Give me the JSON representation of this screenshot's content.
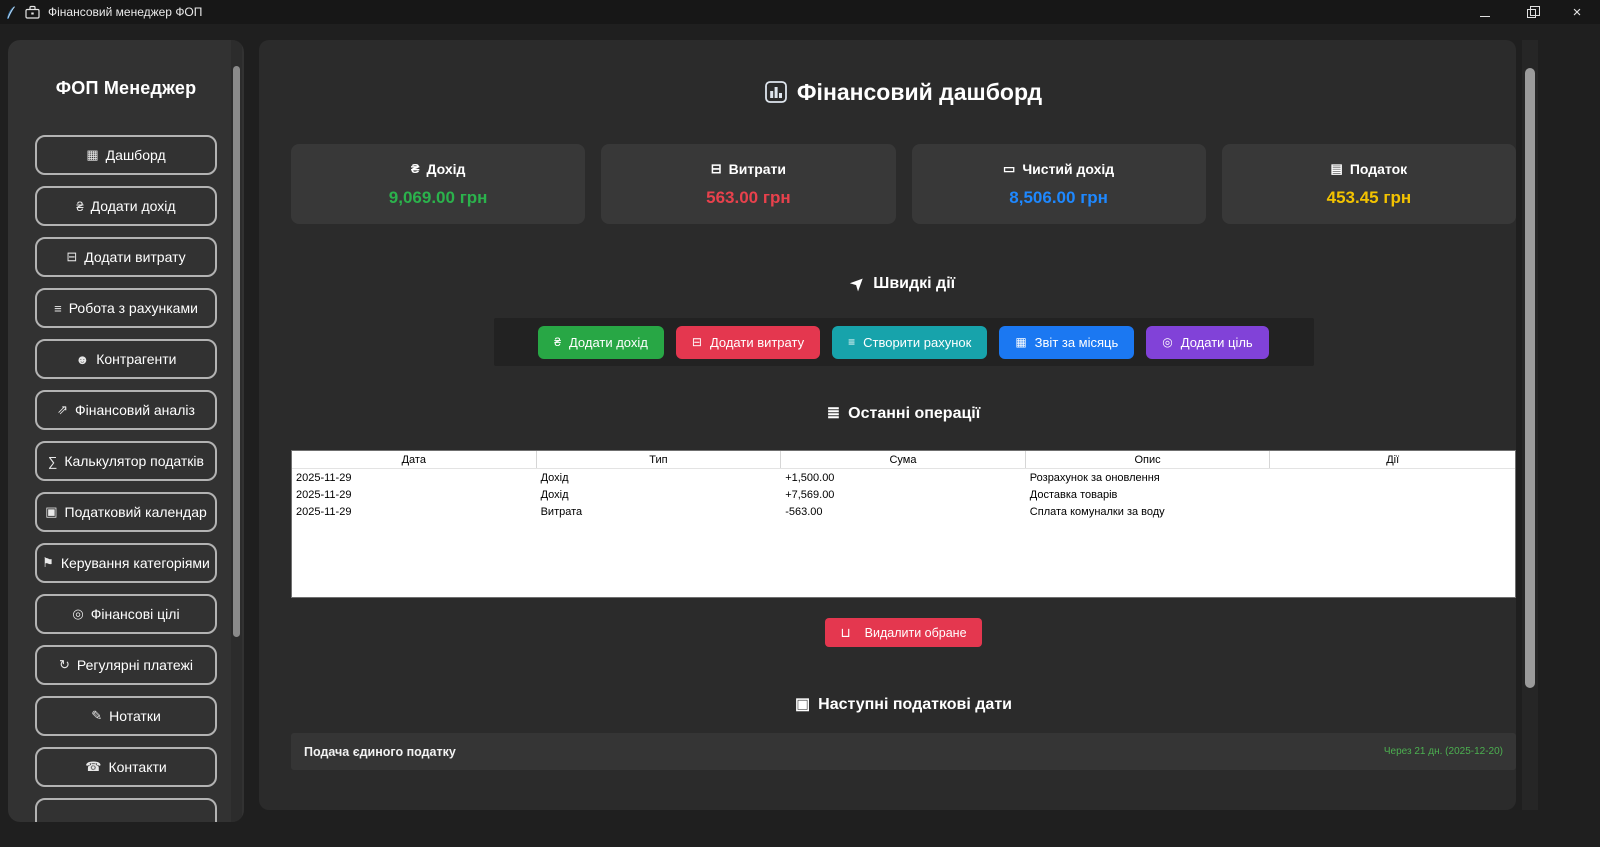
{
  "window": {
    "title": "Фінансовий менеджер ФОП"
  },
  "sidebar": {
    "title": "ФОП Менеджер",
    "items": [
      {
        "icon": "bar-chart-icon",
        "glyph": "▦",
        "label": "Дашборд"
      },
      {
        "icon": "money-bag-icon",
        "glyph": "₴",
        "label": "Додати дохід"
      },
      {
        "icon": "credit-card-icon",
        "glyph": "⊟",
        "label": "Додати витрату"
      },
      {
        "icon": "invoice-icon",
        "glyph": "≡",
        "label": "Робота з рахунками"
      },
      {
        "icon": "users-icon",
        "glyph": "☻",
        "label": "Контрагенти"
      },
      {
        "icon": "chart-up-icon",
        "glyph": "⇗",
        "label": "Фінансовий аналіз"
      },
      {
        "icon": "calculator-icon",
        "glyph": "∑",
        "label": "Калькулятор податків"
      },
      {
        "icon": "calendar-icon",
        "glyph": "▣",
        "label": "Податковий календар"
      },
      {
        "icon": "tag-icon",
        "glyph": "⚑",
        "label": "Керування категоріями"
      },
      {
        "icon": "target-icon",
        "glyph": "◎",
        "label": "Фінансові цілі"
      },
      {
        "icon": "repeat-icon",
        "glyph": "↻",
        "label": "Регулярні платежі"
      },
      {
        "icon": "note-icon",
        "glyph": "✎",
        "label": "Нотатки"
      },
      {
        "icon": "phone-icon",
        "glyph": "☎",
        "label": "Контакти"
      }
    ]
  },
  "dashboard": {
    "title": "Фінансовий дашборд",
    "stats": [
      {
        "icon": "money-bag-icon",
        "glyph": "₴",
        "label": "Дохід",
        "value": "9,069.00 грн",
        "color": "#2bb24c"
      },
      {
        "icon": "credit-card-icon",
        "glyph": "⊟",
        "label": "Витрати",
        "value": "563.00 грн",
        "color": "#e8414c"
      },
      {
        "icon": "banknote-icon",
        "glyph": "▭",
        "label": "Чистий дохід",
        "value": "8,506.00 грн",
        "color": "#1e88ff"
      },
      {
        "icon": "receipt-icon",
        "glyph": "▤",
        "label": "Податок",
        "value": "453.45 грн",
        "color": "#f3c300"
      }
    ],
    "quick": {
      "title": "Швидкі дії",
      "icon": "rocket-icon",
      "rocket_glyph": "➤",
      "buttons": [
        {
          "icon": "money-bag-icon",
          "glyph": "₴",
          "label": "Додати дохід",
          "color": "#28a745"
        },
        {
          "icon": "credit-card-icon",
          "glyph": "⊟",
          "label": "Додати витрату",
          "color": "#e4374f"
        },
        {
          "icon": "invoice-icon",
          "glyph": "≡",
          "label": "Створити рахунок",
          "color": "#17a3ab"
        },
        {
          "icon": "bar-chart-icon",
          "glyph": "▦",
          "label": "Звіт за місяць",
          "color": "#1b78f2"
        },
        {
          "icon": "target-icon",
          "glyph": "◎",
          "label": "Додати ціль",
          "color": "#8142d8"
        }
      ]
    },
    "ops": {
      "title": "Останні операції",
      "icon": "clipboard-icon",
      "clipboard_glyph": "≣",
      "columns": [
        "Дата",
        "Тип",
        "Сума",
        "Опис",
        "Дії"
      ],
      "rows": [
        {
          "date": "2025-11-29",
          "type": "Дохід",
          "amount": "+1,500.00",
          "desc": "Розрахунок за оновлення"
        },
        {
          "date": "2025-11-29",
          "type": "Дохід",
          "amount": "+7,569.00",
          "desc": "Доставка товарів"
        },
        {
          "date": "2025-11-29",
          "type": "Витрата",
          "amount": "-563.00",
          "desc": "Сплата комуналки за воду"
        }
      ],
      "delete_label": "Видалити обране",
      "trash_glyph": "⊔"
    },
    "tax": {
      "title": "Наступні податкові дати",
      "icon": "calendar-icon",
      "calendar_glyph": "▣",
      "items": [
        {
          "name": "Подача єдиного податку",
          "due": "Через 21 дн. (2025-12-20)",
          "due_color": "#4caf50"
        }
      ]
    }
  }
}
